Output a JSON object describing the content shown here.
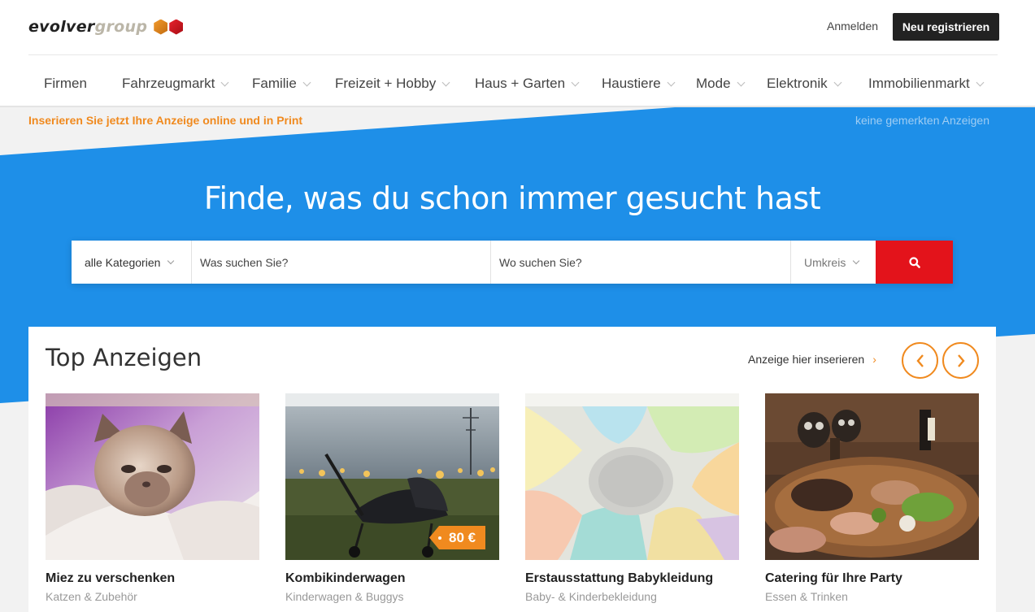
{
  "header": {
    "logo_part1": "evolver",
    "logo_part2": "group",
    "login": "Anmelden",
    "register": "Neu registrieren"
  },
  "nav": [
    {
      "label": "Firmen",
      "dropdown": false
    },
    {
      "label": "Fahrzeugmarkt",
      "dropdown": true
    },
    {
      "label": "Familie",
      "dropdown": true
    },
    {
      "label": "Freizeit + Hobby",
      "dropdown": true
    },
    {
      "label": "Haus + Garten",
      "dropdown": true
    },
    {
      "label": "Haustiere",
      "dropdown": true
    },
    {
      "label": "Mode",
      "dropdown": true
    },
    {
      "label": "Elektronik",
      "dropdown": true
    },
    {
      "label": "Immobilienmarkt",
      "dropdown": true
    }
  ],
  "promo": "Inserieren Sie jetzt Ihre Anzeige online und in Print",
  "saved_ads": "keine gemerkten Anzeigen",
  "hero_title": "Finde, was du schon immer gesucht hast",
  "search": {
    "category": "alle Kategorien",
    "what_placeholder": "Was suchen Sie?",
    "where_placeholder": "Wo suchen Sie?",
    "radius": "Umkreis"
  },
  "top_ads": {
    "title": "Top Anzeigen",
    "insert_link": "Anzeige hier inserieren",
    "cards": [
      {
        "title": "Miez zu verschenken",
        "category": "Katzen & Zubehör",
        "image": "kitten-photo"
      },
      {
        "title": "Kombikinderwagen",
        "category": "Kinderwagen & Buggys",
        "image": "stroller-photo",
        "price": "80 €"
      },
      {
        "title": "Erstausstattung Babykleidung",
        "category": "Baby- & Kinderbekleidung",
        "image": "baby-clothes-photo"
      },
      {
        "title": "Catering für Ihre Party",
        "category": "Essen & Trinken",
        "image": "catering-platter-photo"
      }
    ]
  },
  "colors": {
    "hero_blue": "#1e8fe8",
    "accent_orange": "#f08a1f",
    "search_red": "#e3131b",
    "register_black": "#222222"
  }
}
